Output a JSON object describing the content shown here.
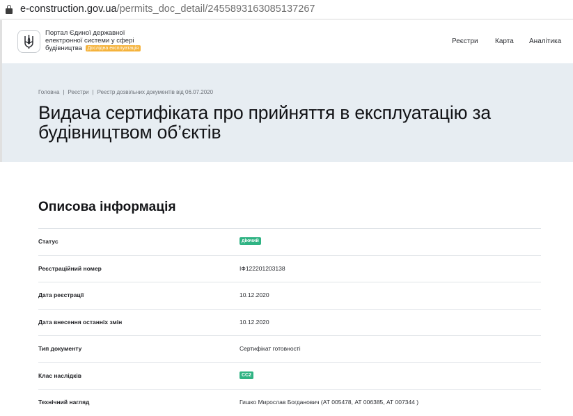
{
  "browser": {
    "url_domain": "e-construction.gov.ua",
    "url_path": "/permits_doc_detail/2455893163085137267"
  },
  "header": {
    "portal_name_line1": "Портал Єдиної державної",
    "portal_name_line2": "електронної системи у сфері",
    "portal_name_line3": "будівництва",
    "beta_badge": "Дослідна експлуатація",
    "nav": {
      "registries": "Реєстри",
      "map": "Карта",
      "analytics": "Аналітика"
    }
  },
  "hero": {
    "breadcrumb": [
      "Головна",
      "Реєстри",
      "Реєстр дозвільних документів від 06.07.2020"
    ],
    "title_line1": "Видача сертифіката про прийняття в експлуатацію за",
    "title_line2": "будівництвом об’єктів"
  },
  "info": {
    "section_title": "Описова інформація",
    "rows": [
      {
        "label": "Статус",
        "value": "діючий"
      },
      {
        "label": "Реєстраційний номер",
        "value": "ІФ122201203138"
      },
      {
        "label": "Дата реєстрації",
        "value": "10.12.2020"
      },
      {
        "label": "Дата внесення останніх змін",
        "value": "10.12.2020"
      },
      {
        "label": "Тип документу",
        "value": "Сертифікат готовності"
      },
      {
        "label": "Клас наслідків",
        "value": "СС2"
      },
      {
        "label": "Технічний нагляд",
        "value": "Гишко Мирослав Богданович (АТ 005478, АТ 006385, АТ 007344 )"
      }
    ]
  },
  "colors": {
    "hero_bg": "#e7edf2",
    "status_tag": "#2fb383",
    "beta_badge": "#f5b33c"
  }
}
